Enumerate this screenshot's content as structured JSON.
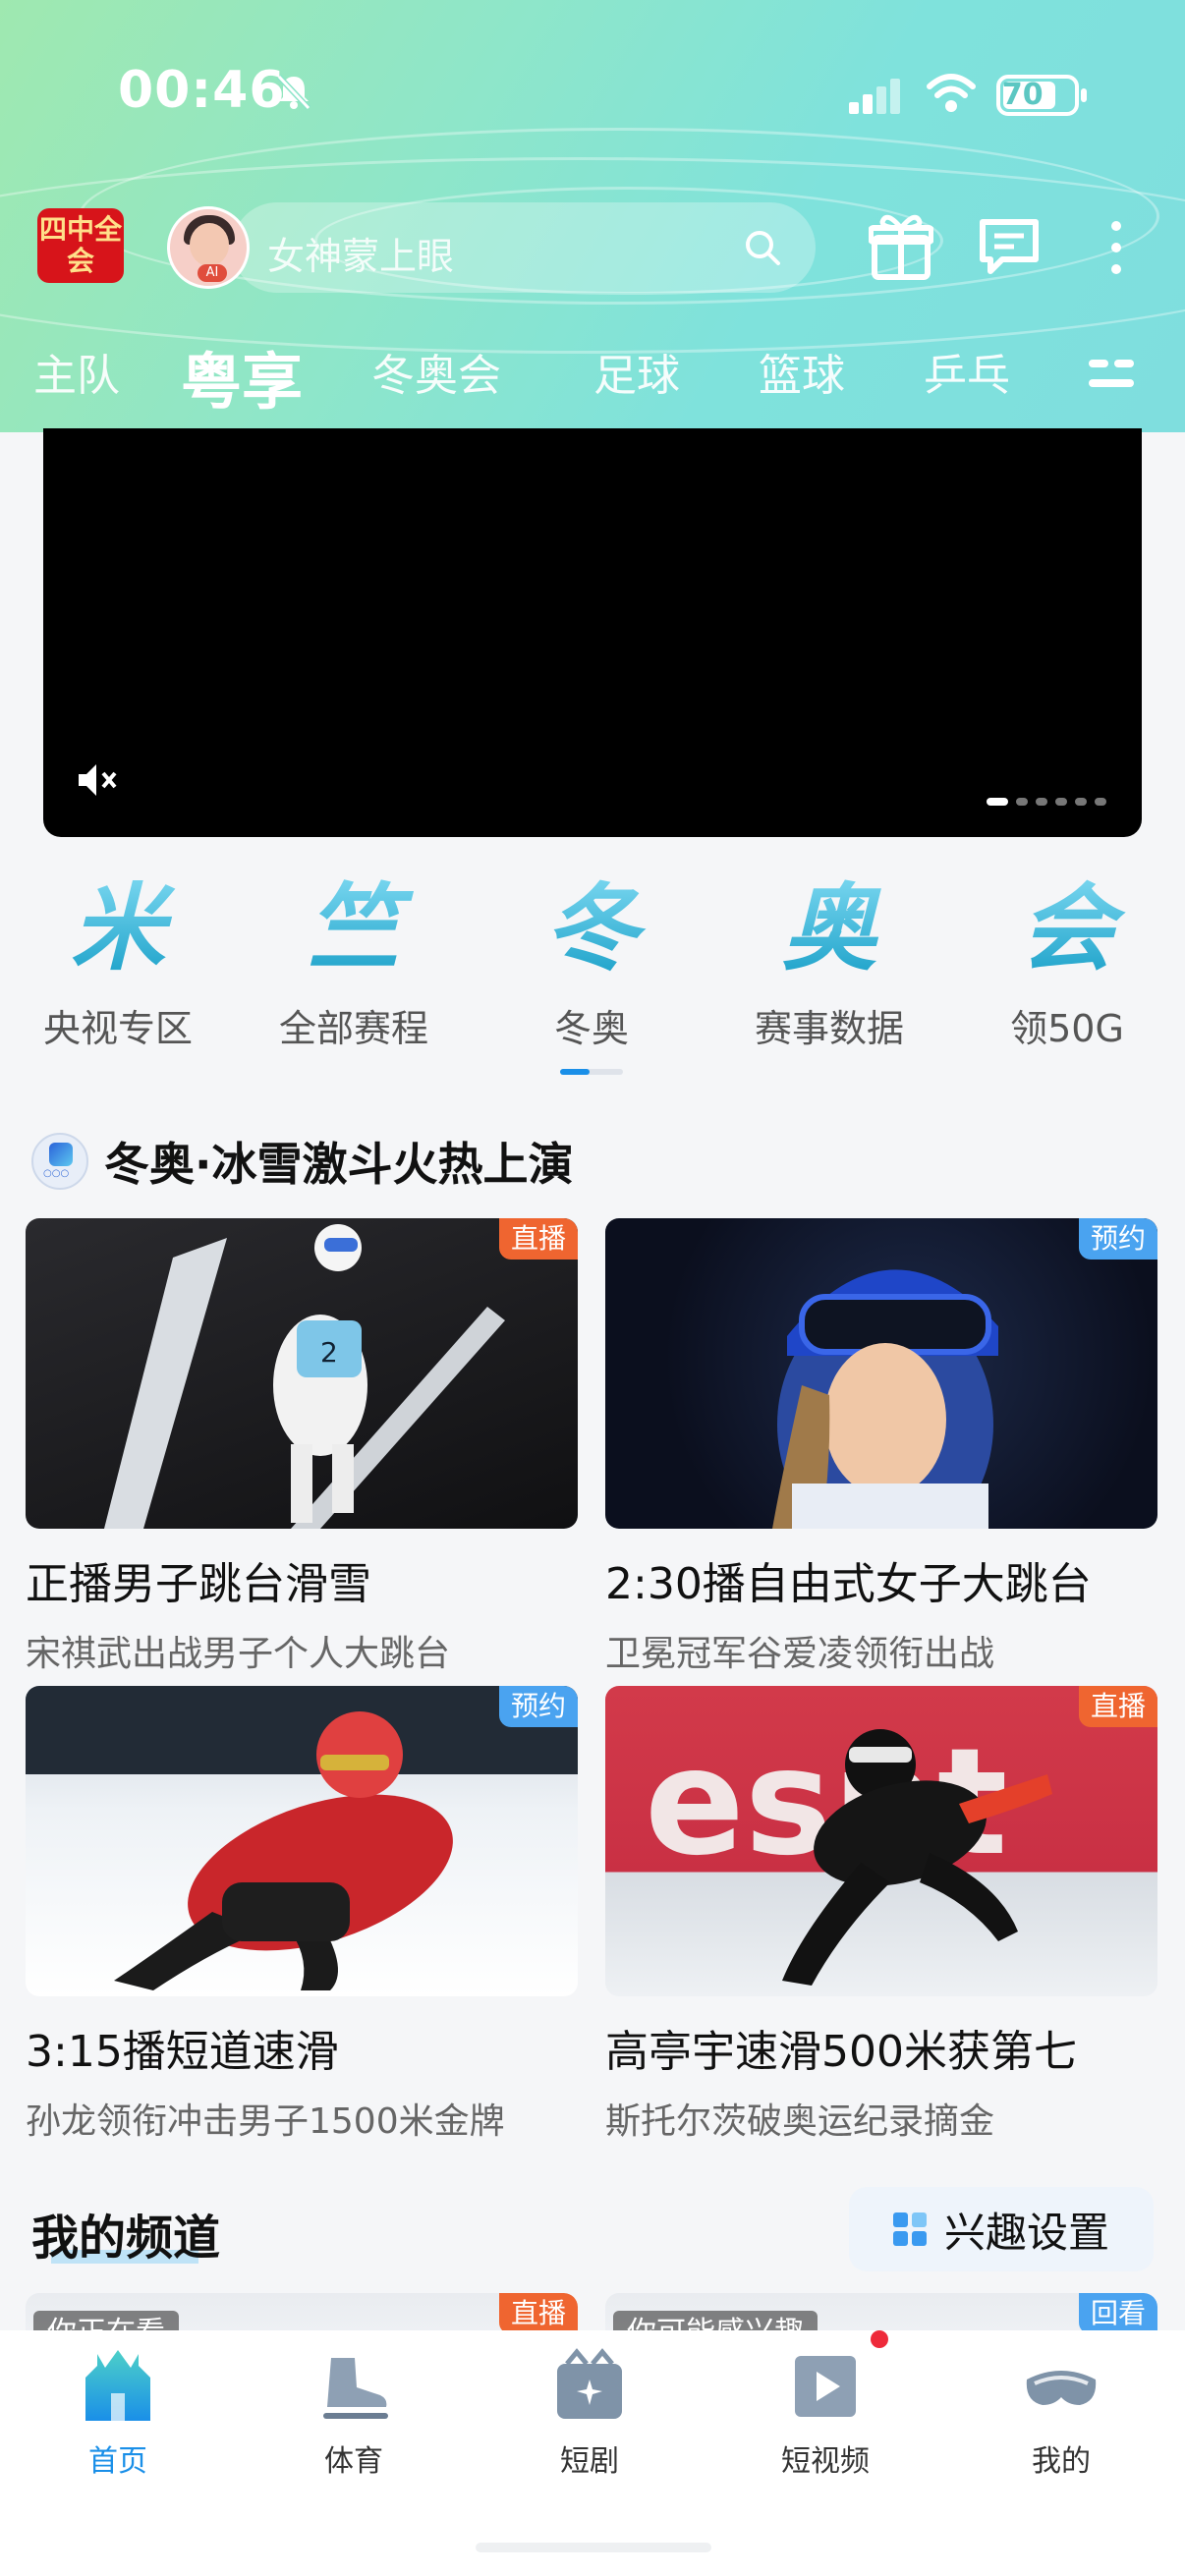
{
  "status_bar": {
    "time": "00:46",
    "battery": "70"
  },
  "header": {
    "logo_text": "四中全会",
    "avatar_badge": "AI",
    "search_placeholder": "女神蒙上眼",
    "tabs": [
      "主队",
      "粤享",
      "冬奥会",
      "足球",
      "篮球",
      "乒乓"
    ],
    "active_tab_index": 1
  },
  "video": {
    "muted": true,
    "slide_count": 6,
    "active_slide": 0
  },
  "channels": {
    "items": [
      {
        "glyph": "米",
        "label": "央视专区"
      },
      {
        "glyph": "竺",
        "label": "全部赛程"
      },
      {
        "glyph": "冬",
        "label": "冬奥"
      },
      {
        "glyph": "奥",
        "label": "赛事数据"
      },
      {
        "glyph": "会",
        "label": "领50G"
      }
    ]
  },
  "section": {
    "title": "冬奥·冰雪激斗火热上演",
    "cards": [
      {
        "badge": "直播",
        "badge_type": "live",
        "title": "正播男子跳台滑雪",
        "subtitle": "宋祺武出战男子个人大跳台"
      },
      {
        "badge": "预约",
        "badge_type": "book",
        "title": "2:30播自由式女子大跳台",
        "subtitle": "卫冕冠军谷爱凌领衔出战"
      },
      {
        "badge": "预约",
        "badge_type": "book",
        "title": "3:15播短道速滑",
        "subtitle": "孙龙领衔冲击男子1500米金牌"
      },
      {
        "badge": "直播",
        "badge_type": "live",
        "title": "高亭宇速滑500米获第七",
        "subtitle": "斯托尔茨破奥运纪录摘金"
      }
    ]
  },
  "my_channel": {
    "title": "我的频道",
    "interest_button": "兴趣设置",
    "peek_cards": [
      {
        "tag": "你正在看",
        "badge": "直播"
      },
      {
        "tag": "你可能感兴趣",
        "badge": "回看"
      }
    ]
  },
  "bottom_nav": {
    "items": [
      "首页",
      "体育",
      "短剧",
      "短视频",
      "我的"
    ],
    "active_index": 0
  },
  "colors": {
    "accent": "#1a8fe8",
    "live_badge": "#ef6530",
    "book_badge": "#4aa3f0"
  }
}
